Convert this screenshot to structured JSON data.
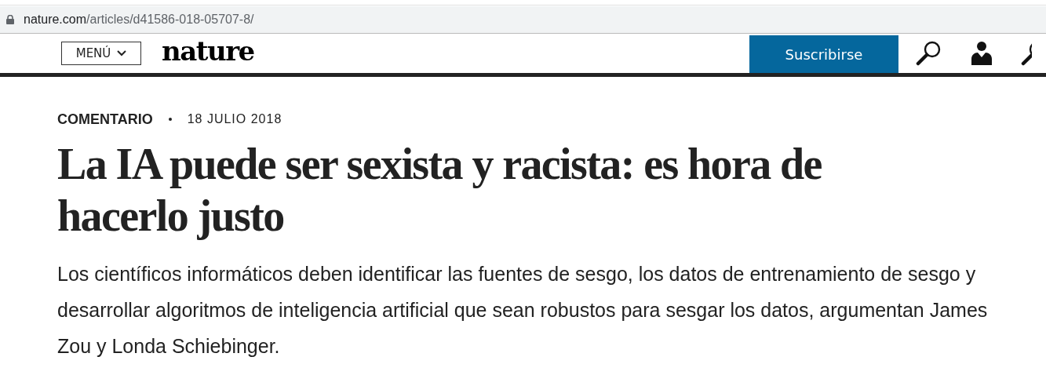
{
  "address_bar": {
    "host": "nature.com",
    "path": "/articles/d41586-018-05707-8/"
  },
  "header": {
    "menu_button": "MENÚ",
    "logo": "nature",
    "subscribe_button": "Suscribirse"
  },
  "article": {
    "type": "COMENTARIO",
    "date": "18 JULIO 2018",
    "title": "La IA puede ser sexista y racista: es hora de hacerlo justo",
    "standfirst": "Los científicos informáticos deben identificar las fuentes de sesgo, los datos de entrenamiento de sesgo y desarrollar algoritmos de inteligencia artificial que sean robustos para sesgar los datos, argumentan James Zou y Londa Schiebinger."
  }
}
